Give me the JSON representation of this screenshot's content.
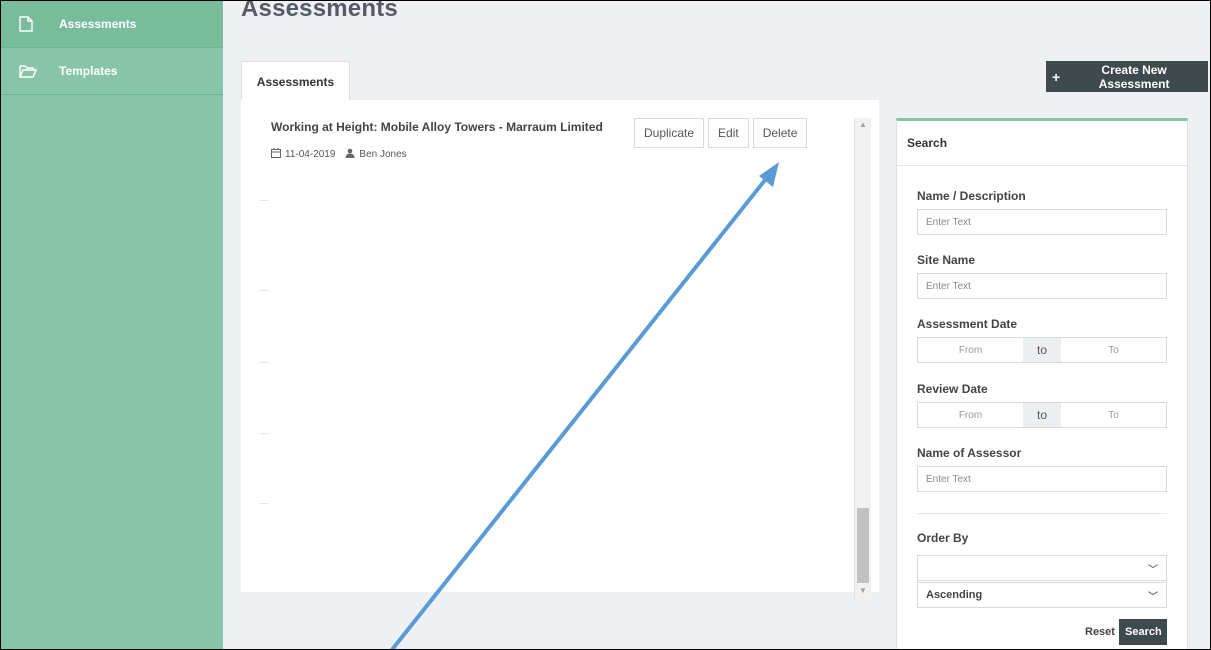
{
  "sidebar": {
    "items": [
      {
        "label": "Assessments",
        "icon": "document-icon",
        "active": true
      },
      {
        "label": "Templates",
        "icon": "folder-open-icon",
        "active": false
      }
    ]
  },
  "page": {
    "title": "Assessments"
  },
  "toolbar": {
    "create_label": "Create New Assessment"
  },
  "tabs": [
    {
      "label": "Assessments"
    }
  ],
  "assessment": {
    "title": "Working at Height: Mobile Alloy Towers - Marraum Limited",
    "date": "11-04-2019",
    "author": "Ben Jones",
    "actions": {
      "duplicate": "Duplicate",
      "edit": "Edit",
      "delete": "Delete"
    }
  },
  "search": {
    "heading": "Search",
    "name_label": "Name / Description",
    "name_placeholder": "Enter Text",
    "site_label": "Site Name",
    "site_placeholder": "Enter Text",
    "assessment_date_label": "Assessment Date",
    "review_date_label": "Review Date",
    "range_from": "From",
    "range_to_sep": "to",
    "range_to": "To",
    "assessor_label": "Name of Assessor",
    "assessor_placeholder": "Enter Text",
    "order_label": "Order By",
    "order_field_value": "",
    "order_direction": "Ascending",
    "reset_label": "Reset",
    "search_label": "Search"
  },
  "colors": {
    "sidebar": "#86c5a7",
    "dark_button": "#3f4a4e",
    "annotation_arrow": "#5b9bd5"
  }
}
